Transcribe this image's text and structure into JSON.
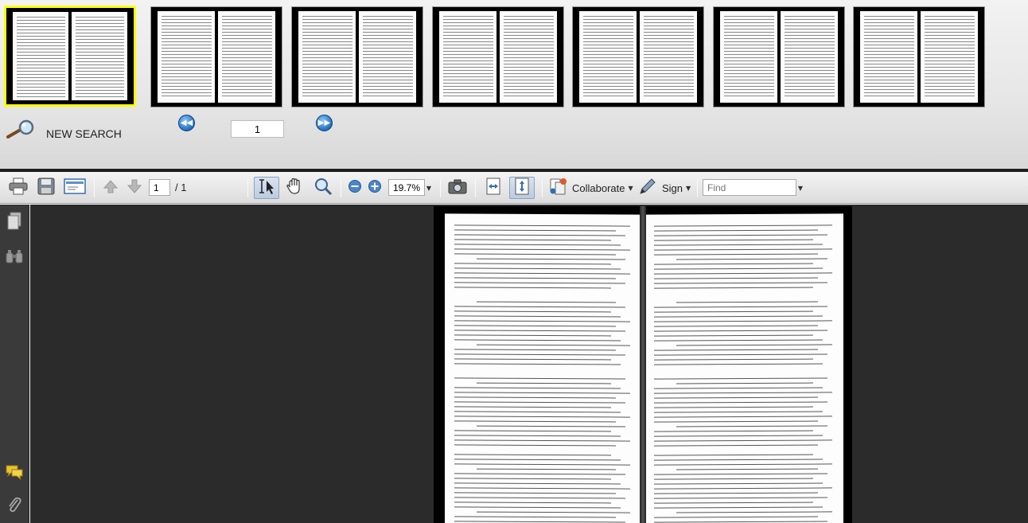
{
  "thumbnails": {
    "count": 7,
    "selected_index": 0
  },
  "search": {
    "label": "NEW SEARCH",
    "icon": "magnifier-icon"
  },
  "pager": {
    "prev_icon": "rewind-icon",
    "next_icon": "fast-forward-icon",
    "current_page": "1"
  },
  "toolbar": {
    "page_number": "1",
    "page_total": "/ 1",
    "zoom": "19.7%",
    "collaborate_label": "Collaborate",
    "sign_label": "Sign",
    "find_placeholder": "Find"
  },
  "colors": {
    "selected_thumb_border": "#ffff00",
    "nav_button": "#1f6fc2",
    "pane_background": "#3a3a3a",
    "doc_background": "#2b2b2b"
  }
}
